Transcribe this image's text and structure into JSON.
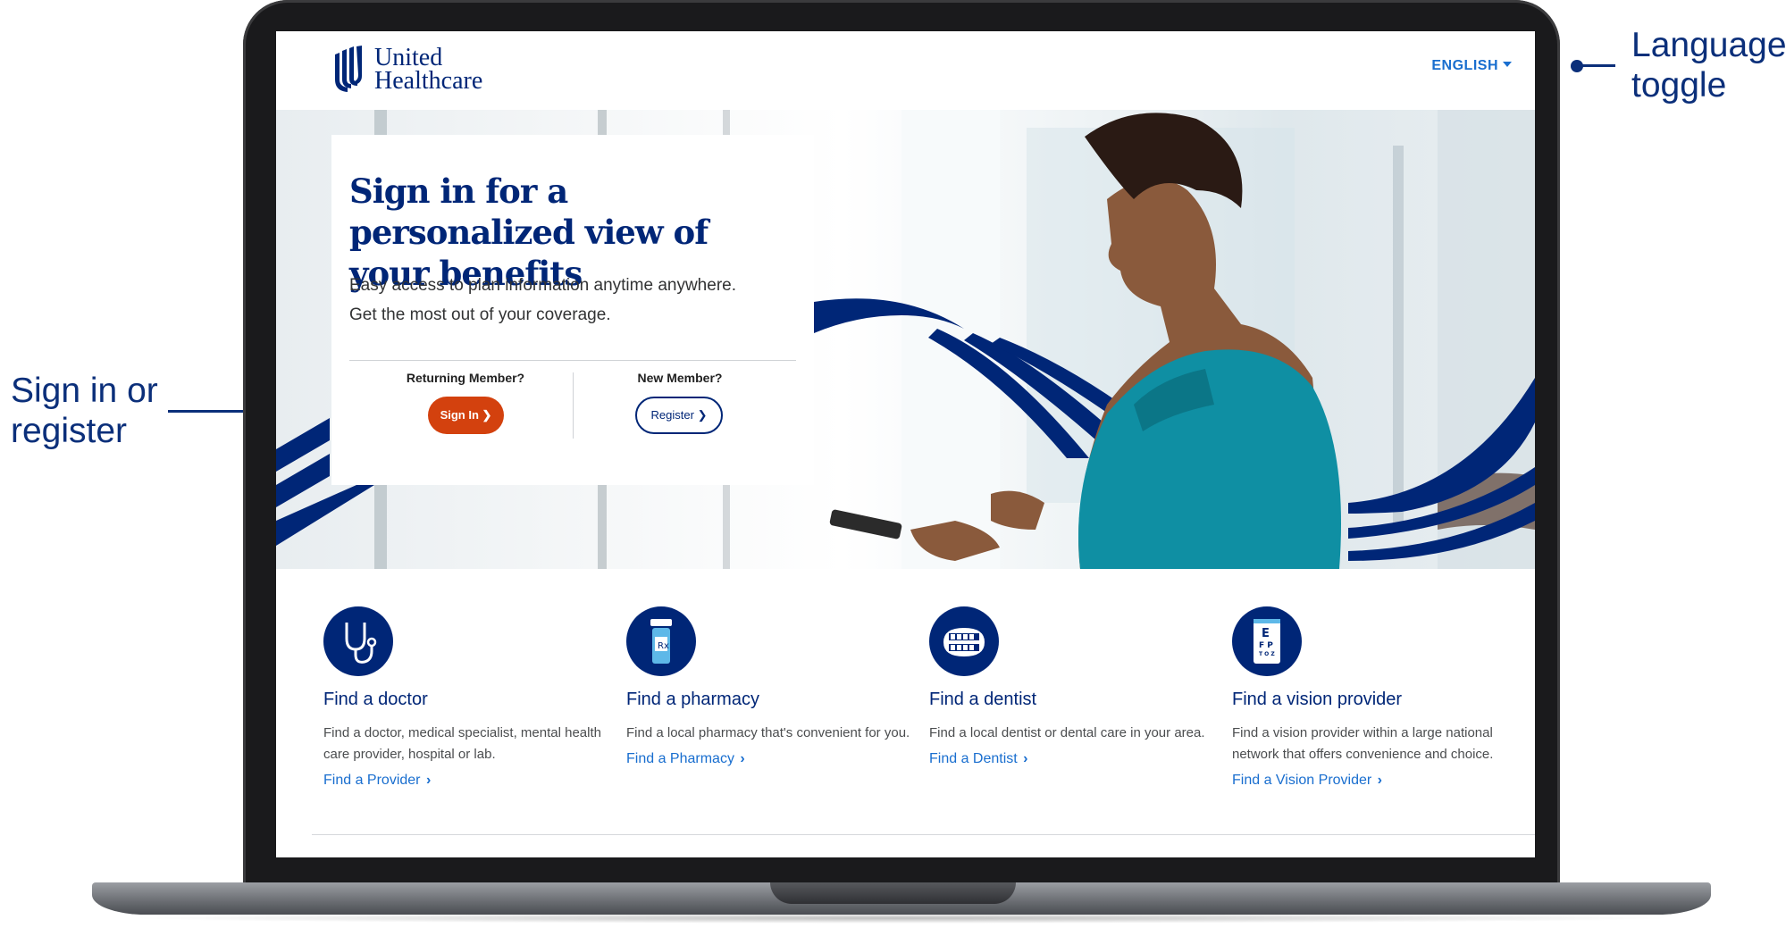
{
  "callouts": {
    "left_label": "Sign in or register",
    "left_lines": [
      "Sign in or",
      "register"
    ],
    "right_lines": [
      "Language",
      "toggle"
    ]
  },
  "header": {
    "logo_line1": "United",
    "logo_line2": "Healthcare",
    "language": "ENGLISH"
  },
  "hero": {
    "title": "Sign in for a personalized view of your benefits",
    "subtitle_line1": "Easy access to plan information anytime anywhere.",
    "subtitle_line2": "Get the most out of your coverage.",
    "returning_label": "Returning Member?",
    "signin_button": "Sign In",
    "new_label": "New Member?",
    "register_button": "Register"
  },
  "features": [
    {
      "icon": "stethoscope-icon",
      "title": "Find a doctor",
      "description": "Find a doctor, medical specialist, mental health care provider, hospital or lab.",
      "link": "Find a Provider"
    },
    {
      "icon": "pill-bottle-icon",
      "title": "Find a pharmacy",
      "description": "Find a local pharmacy that's convenient for you.",
      "link": "Find a Pharmacy"
    },
    {
      "icon": "teeth-icon",
      "title": "Find a dentist",
      "description": "Find a local dentist or dental care in your area.",
      "link": "Find a Dentist"
    },
    {
      "icon": "eye-chart-icon",
      "title": "Find a vision provider",
      "description": "Find a vision provider within a large national network that offers convenience and choice.",
      "link": "Find a Vision Provider"
    }
  ],
  "colors": {
    "brand_navy": "#002677",
    "link_blue": "#196ecf",
    "signin_orange": "#d3410e",
    "callout": "#0b2f7a"
  }
}
